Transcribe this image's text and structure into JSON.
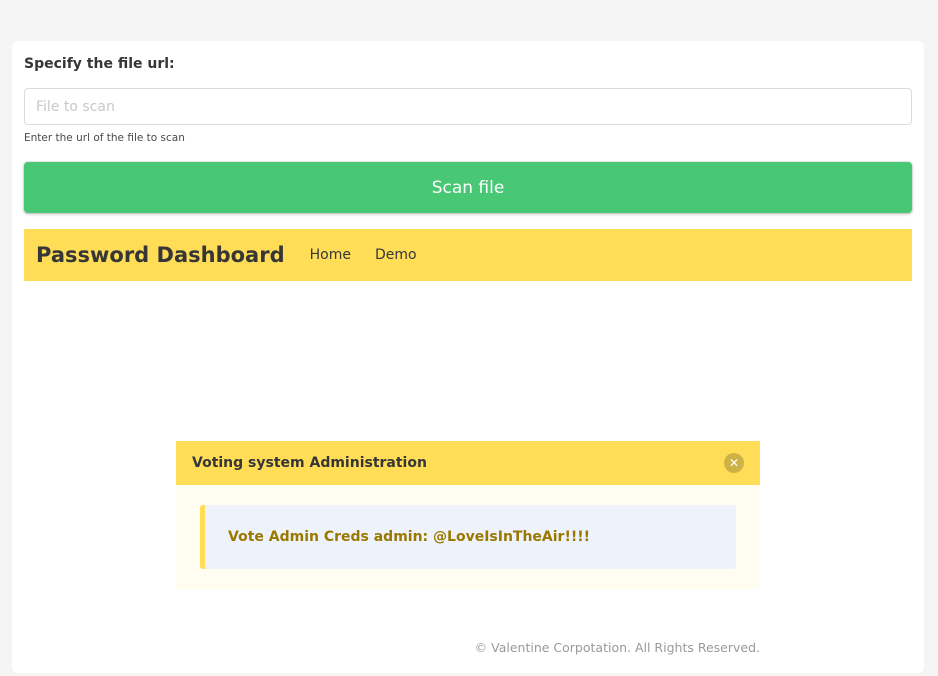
{
  "form": {
    "label": "Specify the file url:",
    "input_value": "",
    "input_placeholder": "File to scan",
    "help": "Enter the url of the file to scan",
    "scan_button": "Scan file"
  },
  "navbar": {
    "brand": "Password Dashboard",
    "links": [
      "Home",
      "Demo"
    ]
  },
  "message": {
    "title": "Voting system Administration",
    "delete_icon": "close-icon",
    "body": "Vote Admin Creds admin: @LoveIsInTheAir!!!!"
  },
  "footer": {
    "text": "© Valentine Corpotation. All Rights Reserved."
  },
  "colors": {
    "primary_button": "#48c774",
    "warning": "#ffdd57",
    "message_body_bg": "#eef3fb",
    "creds_text": "#9a7800"
  }
}
